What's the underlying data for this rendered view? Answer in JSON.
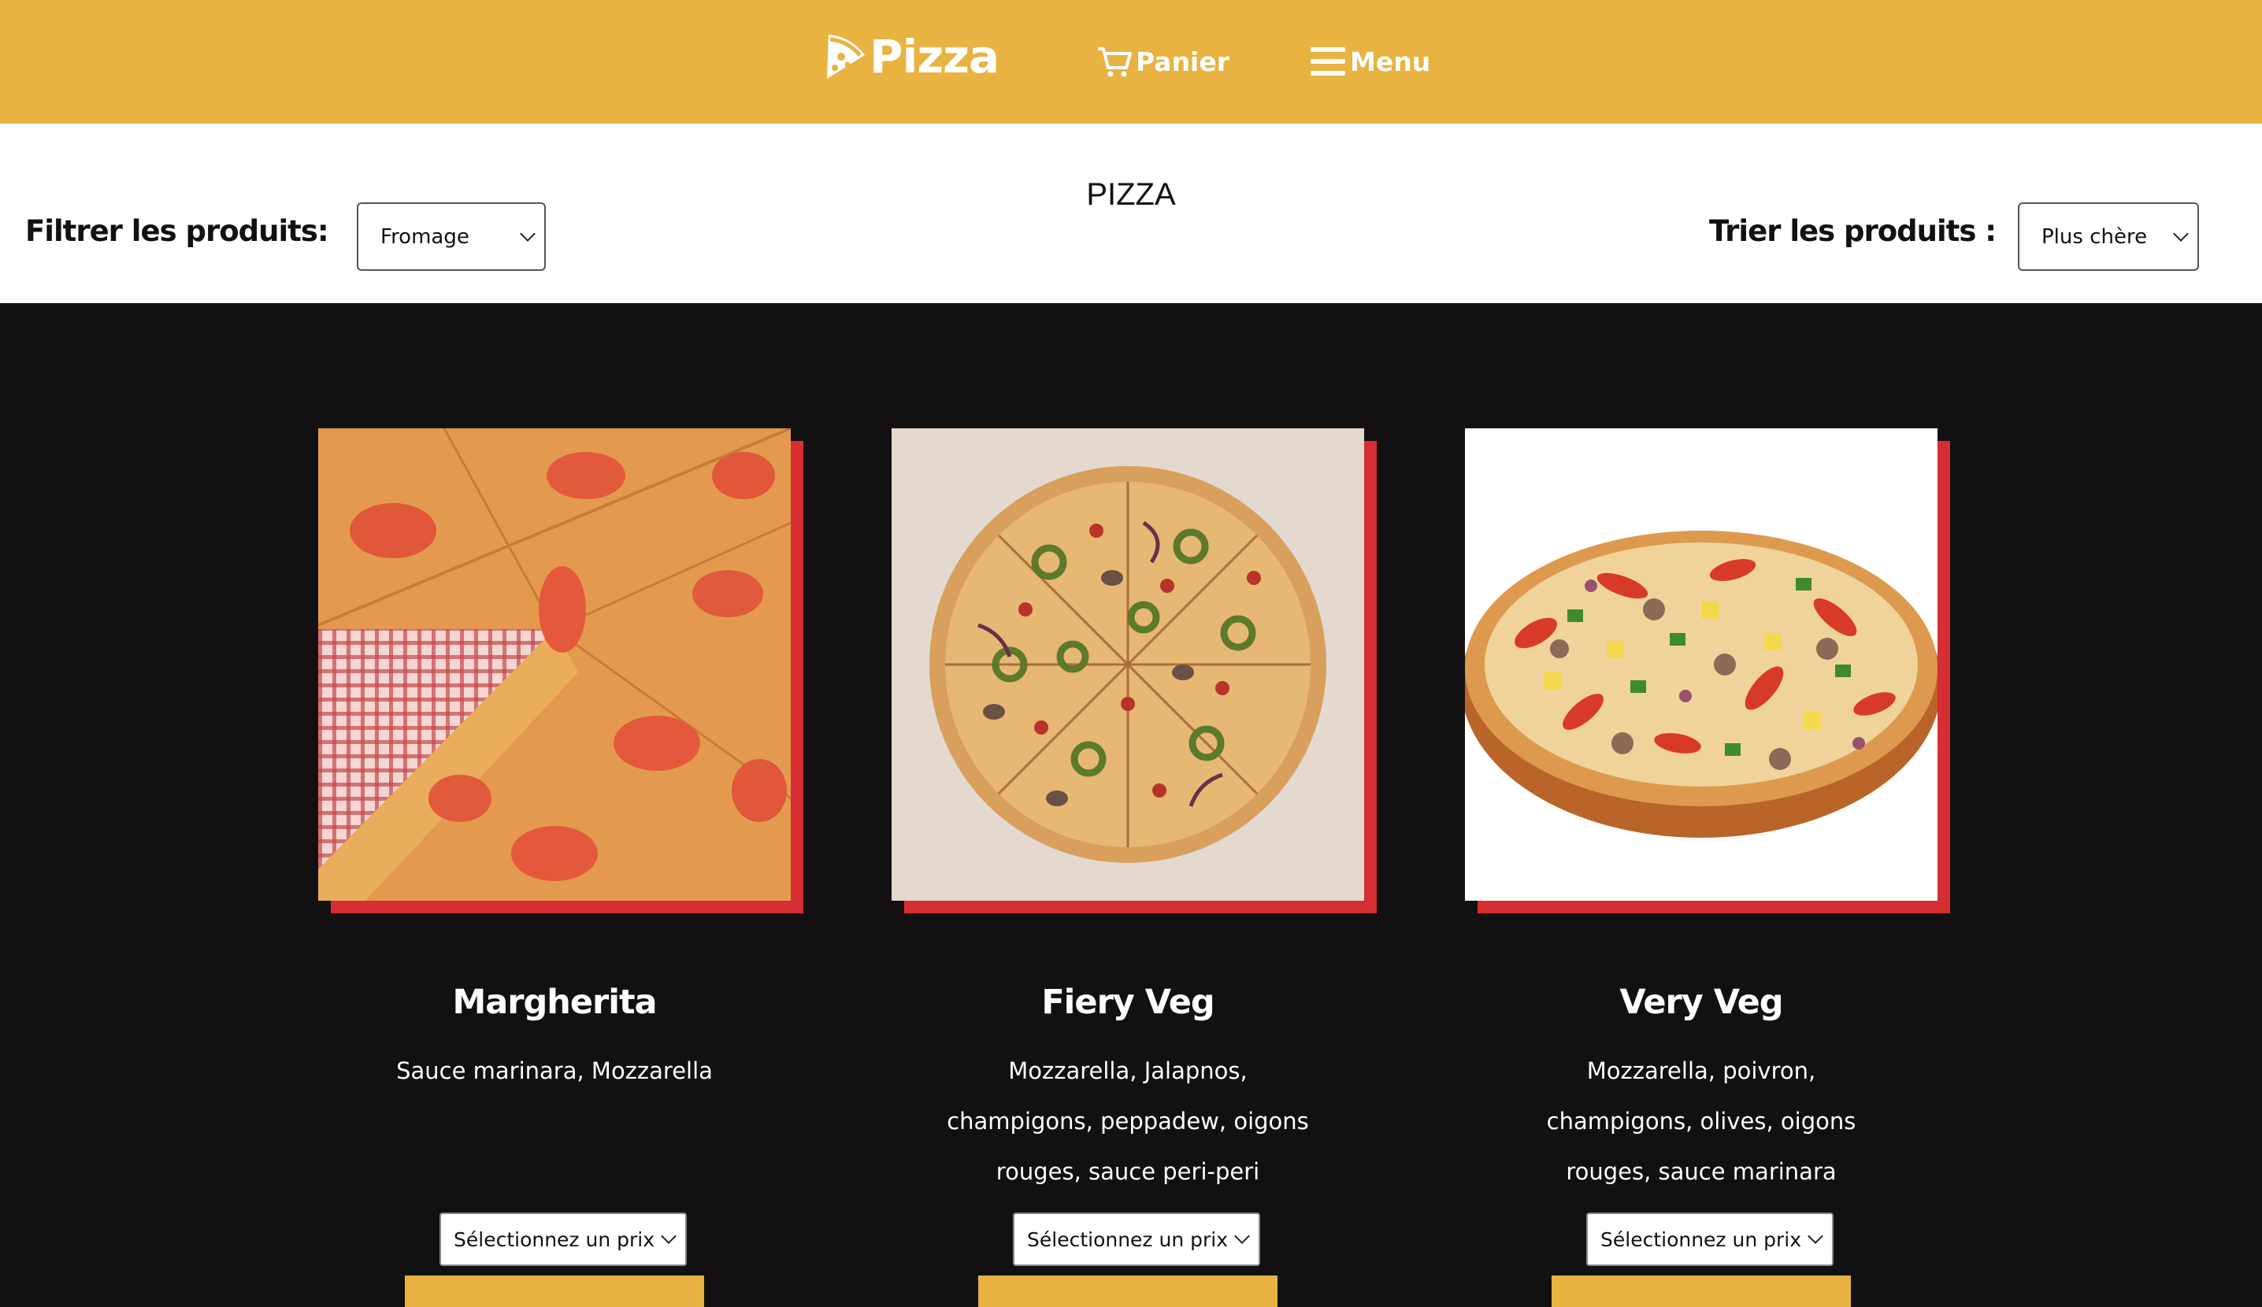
{
  "header": {
    "logo_text": "Pizza",
    "cart_label": "Panier",
    "menu_label": "Menu"
  },
  "filters": {
    "page_title": "PIZZA",
    "filter_label": "Filtrer les produits:",
    "filter_value": "Fromage",
    "sort_label": "Trier les produits :",
    "sort_value": "Plus chère"
  },
  "products": [
    {
      "name": "Margherita",
      "description": "Sauce marinara, Mozzarella",
      "price_select": "Sélectionnez un prix",
      "image": "margherita-pizza-photo"
    },
    {
      "name": "Fiery Veg",
      "description": "Mozzarella, Jalapnos, champigons, peppadew, oigons rouges, sauce peri-peri",
      "price_select": "Sélectionnez un prix",
      "image": "fiery-veg-pizza-photo"
    },
    {
      "name": "Very Veg",
      "description": "Mozzarella, poivron, champigons, olives, oigons rouges, sauce marinara",
      "price_select": "Sélectionnez un prix",
      "image": "very-veg-pizza-photo"
    }
  ],
  "colors": {
    "header_bg": "#e8b341",
    "accent_red": "#d52f33",
    "page_bg": "#131011"
  }
}
